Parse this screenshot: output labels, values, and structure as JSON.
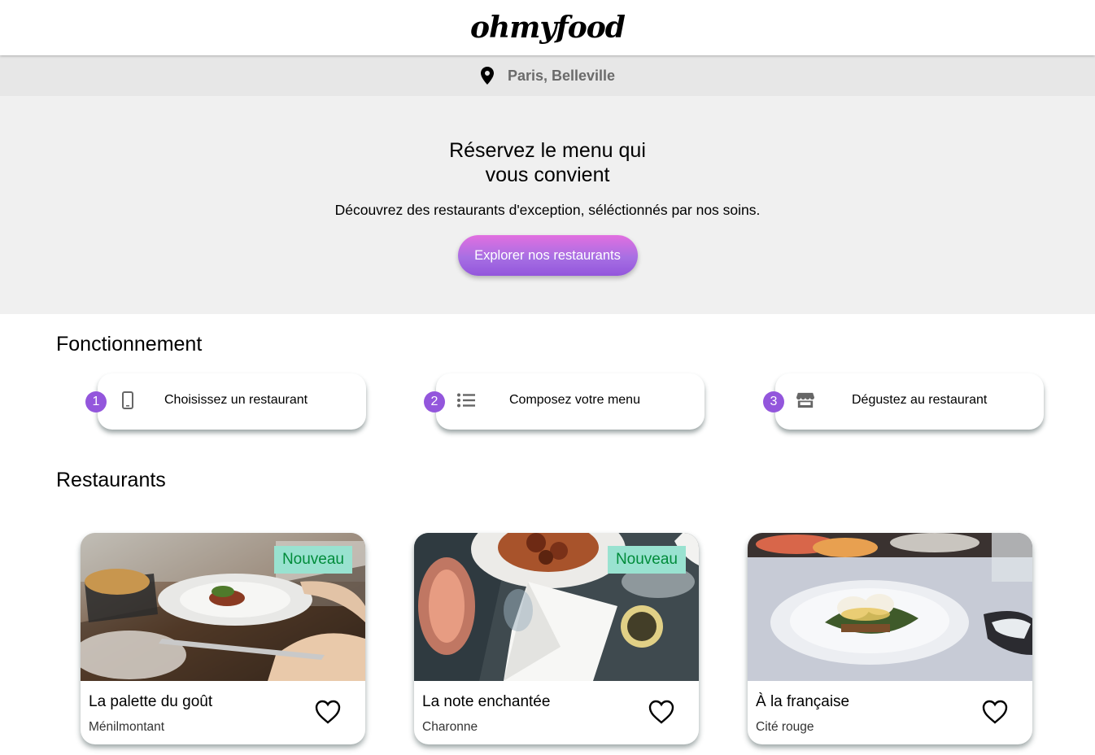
{
  "header": {
    "logo": "ohmyfood"
  },
  "location": {
    "icon": "map-pin-icon",
    "text": "Paris, Belleville"
  },
  "hero": {
    "title": "Réservez le menu qui vous convient",
    "subtitle": "Découvrez des restaurants d'exception, séléctionnés par nos soins.",
    "cta_label": "Explorer nos restaurants"
  },
  "how_it_works": {
    "title": "Fonctionnement",
    "steps": [
      {
        "number": "1",
        "icon": "mobile-phone-icon",
        "label": "Choisissez un restaurant"
      },
      {
        "number": "2",
        "icon": "list-icon",
        "label": "Composez votre menu"
      },
      {
        "number": "3",
        "icon": "store-icon",
        "label": "Dégustez au restaurant"
      }
    ]
  },
  "restaurants": {
    "title": "Restaurants",
    "items": [
      {
        "name": "La palette du goût",
        "area": "Ménilmontant",
        "badge": "Nouveau",
        "icon": "heart-icon"
      },
      {
        "name": "La note enchantée",
        "area": "Charonne",
        "badge": "Nouveau",
        "icon": "heart-icon"
      },
      {
        "name": "À la française",
        "area": "Cité rouge",
        "badge": "",
        "icon": "heart-icon"
      }
    ]
  },
  "colors": {
    "accent_purple": "#9356dc",
    "cta_gradient_top": "#e16fe0",
    "badge_bg": "#99e2d0",
    "badge_text": "#008b3a"
  }
}
